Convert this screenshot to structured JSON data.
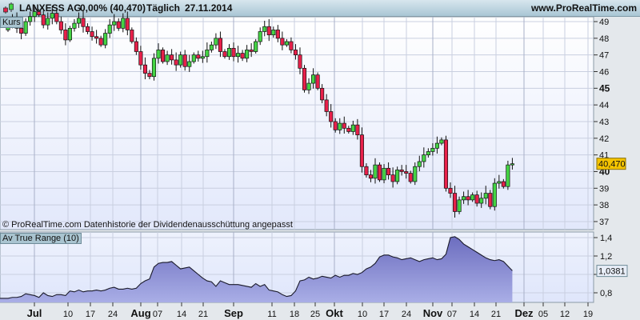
{
  "header": {
    "instrument": "LANXESS AG",
    "change": "0,00% (40,470)",
    "period": "Täglich",
    "date": "27.11.2014",
    "site": "www.ProRealTime.com"
  },
  "price_panel_label": "Kurs",
  "footer_note": "© ProRealTime.com  Datenhistorie der Dividendenausschüttung angepasst",
  "atr_panel_label": "Av True Range (10)",
  "colors": {
    "up": "#44d444",
    "down": "#e8204a",
    "atr_fill": "#7f80c8",
    "last_badge": "#f5c400"
  },
  "chart_data": [
    {
      "type": "candlestick",
      "title": "LANXESS AG",
      "last_value": "40,470",
      "ylim": [
        36.5,
        49.5
      ],
      "yticks": [
        "49",
        "48",
        "47",
        "46",
        "45",
        "44",
        "43",
        "42",
        "41",
        "40",
        "39",
        "38",
        "37"
      ],
      "closes": [
        48.8,
        49.2,
        48.6,
        48.3,
        49.0,
        49.3,
        49.6,
        49.4,
        48.8,
        49.2,
        49.5,
        49.0,
        48.5,
        47.9,
        48.6,
        48.9,
        49.2,
        48.7,
        48.4,
        48.1,
        48.0,
        47.6,
        48.3,
        48.8,
        49.0,
        48.6,
        49.2,
        48.5,
        47.8,
        47.2,
        46.4,
        45.9,
        45.7,
        46.8,
        47.3,
        46.6,
        47.0,
        46.7,
        46.4,
        47.0,
        46.3,
        46.6,
        47.0,
        46.8,
        46.9,
        47.3,
        47.6,
        48.0,
        47.2,
        46.9,
        47.4,
        46.9,
        47.1,
        46.8,
        47.3,
        47.2,
        47.8,
        48.4,
        48.7,
        48.2,
        48.5,
        48.0,
        47.6,
        47.8,
        47.3,
        47.0,
        46.2,
        44.9,
        45.3,
        45.8,
        45.0,
        44.3,
        43.6,
        43.0,
        42.5,
        42.9,
        42.6,
        42.4,
        42.8,
        42.2,
        40.3,
        39.8,
        39.6,
        40.4,
        39.5,
        40.2,
        39.8,
        39.4,
        40.1,
        40.0,
        39.9,
        39.4,
        40.3,
        40.6,
        41.0,
        41.2,
        41.4,
        41.7,
        41.9,
        39.0,
        38.7,
        37.6,
        38.3,
        38.5,
        38.3,
        38.6,
        38.1,
        38.4,
        38.7,
        37.9,
        39.3,
        39.4,
        39.1,
        40.4,
        40.47
      ]
    },
    {
      "type": "area",
      "title": "Av True Range (10)",
      "last_value": "1,0381",
      "ylim": [
        0.7,
        1.45
      ],
      "yticks": [
        "1,4",
        "1,2",
        "0,8"
      ],
      "values": [
        0.74,
        0.75,
        0.75,
        0.76,
        0.79,
        0.78,
        0.77,
        0.75,
        0.8,
        0.77,
        0.76,
        0.78,
        0.78,
        0.77,
        0.82,
        0.81,
        0.83,
        0.81,
        0.82,
        0.82,
        0.83,
        0.82,
        0.83,
        0.85,
        0.86,
        0.84,
        0.84,
        0.85,
        0.84,
        0.85,
        0.9,
        0.93,
        0.95,
        1.08,
        1.12,
        1.13,
        1.13,
        1.14,
        1.1,
        1.06,
        1.07,
        1.08,
        1.04,
        1.0,
        0.96,
        0.93,
        0.92,
        0.87,
        0.93,
        0.91,
        0.89,
        0.89,
        0.89,
        0.88,
        0.87,
        0.86,
        0.9,
        0.87,
        0.89,
        0.83,
        0.82,
        0.81,
        0.78,
        0.76,
        0.77,
        0.82,
        0.93,
        0.94,
        0.97,
        0.95,
        0.96,
        0.98,
        0.97,
        0.96,
        0.99,
        0.97,
        0.99,
        0.99,
        1.01,
        1.0,
        1.02,
        1.06,
        1.08,
        1.12,
        1.19,
        1.21,
        1.21,
        1.19,
        1.18,
        1.16,
        1.17,
        1.18,
        1.16,
        1.14,
        1.16,
        1.17,
        1.18,
        1.16,
        1.17,
        1.22,
        1.4,
        1.41,
        1.38,
        1.33,
        1.3,
        1.27,
        1.24,
        1.21,
        1.18,
        1.16,
        1.15,
        1.16,
        1.14,
        1.09,
        1.04
      ]
    }
  ],
  "xaxis": [
    {
      "l": "Jul",
      "b": true
    },
    {
      "l": "10"
    },
    {
      "l": "17"
    },
    {
      "l": "24"
    },
    {
      "l": "Aug",
      "b": true
    },
    {
      "l": "07"
    },
    {
      "l": "14"
    },
    {
      "l": "21"
    },
    {
      "l": "Sep",
      "b": true
    },
    {
      "l": "11"
    },
    {
      "l": "18"
    },
    {
      "l": "25"
    },
    {
      "l": "Okt",
      "b": true
    },
    {
      "l": "10"
    },
    {
      "l": "17"
    },
    {
      "l": "24"
    },
    {
      "l": "Nov",
      "b": true
    },
    {
      "l": "07"
    },
    {
      "l": "14"
    },
    {
      "l": "21"
    },
    {
      "l": "Dez",
      "b": true
    },
    {
      "l": "05"
    },
    {
      "l": "12"
    },
    {
      "l": "19"
    }
  ]
}
